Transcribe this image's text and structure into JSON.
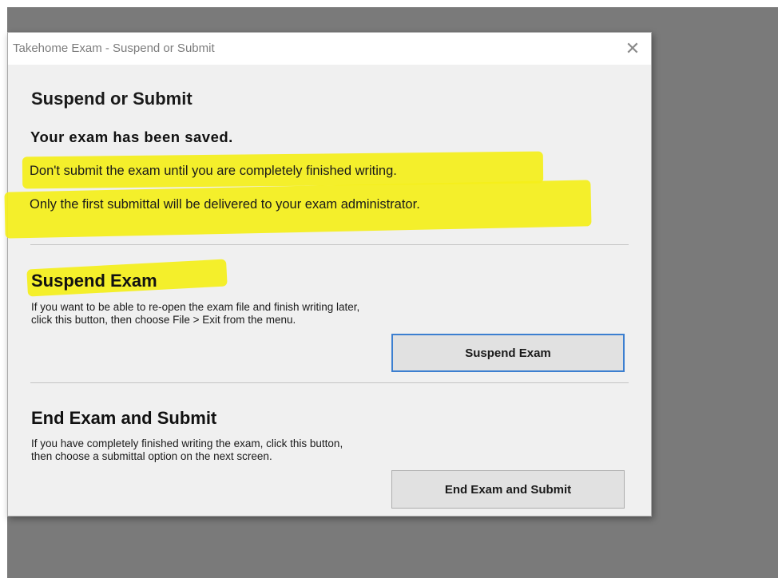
{
  "window": {
    "title": "Takehome Exam - Suspend or Submit",
    "close_glyph": "✕"
  },
  "header": {
    "title": "Suspend or Submit",
    "saved_message": "Your exam has been saved.",
    "note_1": "Don't submit the exam until you are completely finished writing.",
    "note_2": "Only the first submittal will be delivered to your exam administrator."
  },
  "suspend": {
    "title": "Suspend Exam",
    "description": "If you want to be able to re-open the exam file and finish writing later, click this button, then choose File > Exit from the menu.",
    "button_label": "Suspend Exam"
  },
  "submit": {
    "title": "End Exam and Submit",
    "description": "If you have completely finished writing the exam, click this button, then choose a submittal option on the next screen.",
    "button_label": "End Exam and Submit"
  },
  "colors": {
    "highlight": "#f4ef1a",
    "focus_border": "#3c7fd0",
    "desktop": "#7a7a7a"
  }
}
